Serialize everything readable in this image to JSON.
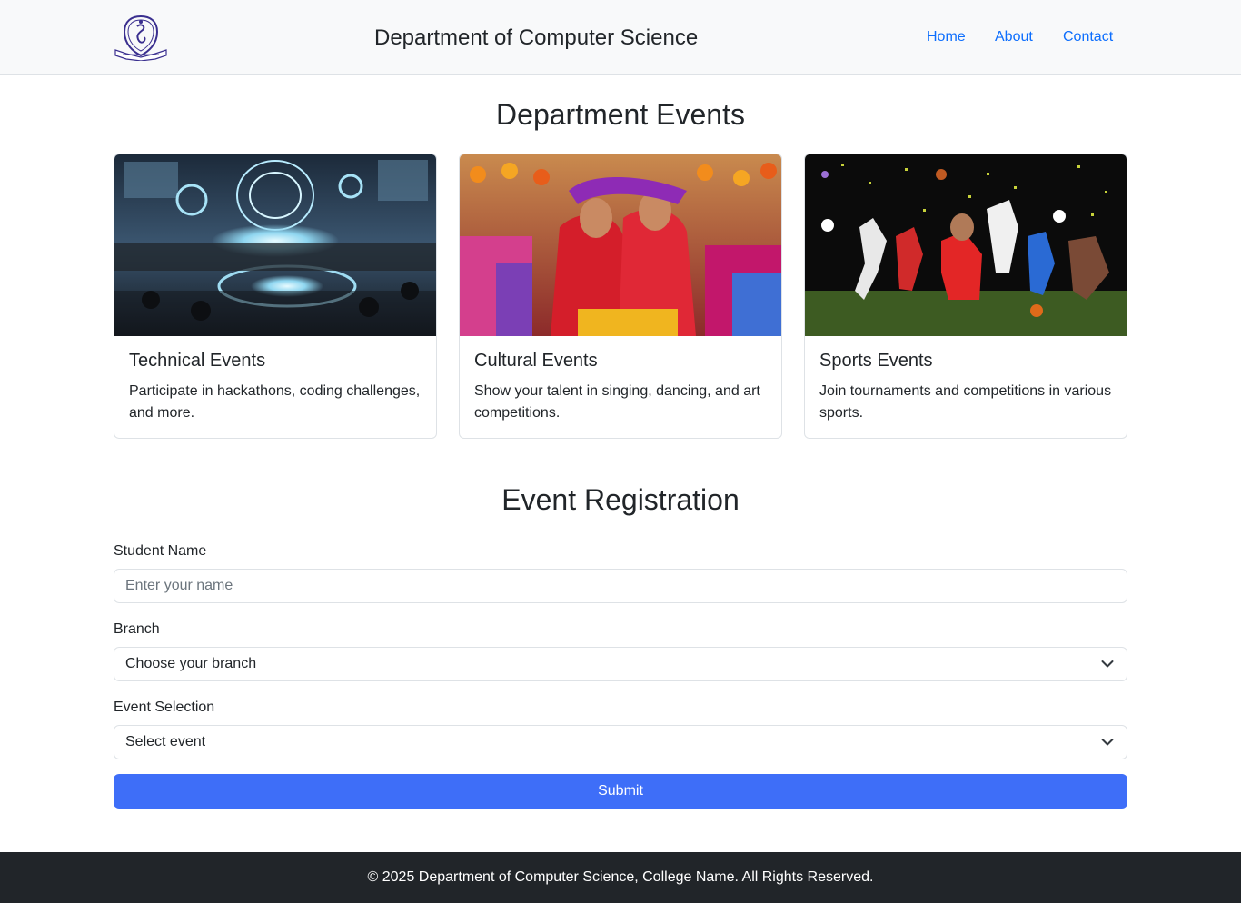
{
  "navbar": {
    "logo_icon": "college-crest-icon",
    "title": "Department of Computer Science",
    "links": [
      {
        "label": "Home"
      },
      {
        "label": "About"
      },
      {
        "label": "Contact"
      }
    ]
  },
  "events_section": {
    "heading": "Department Events",
    "cards": [
      {
        "title": "Technical Events",
        "text": "Participate in hackathons, coding challenges, and more.",
        "image": "technical-events-image"
      },
      {
        "title": "Cultural Events",
        "text": "Show your talent in singing, dancing, and art competitions.",
        "image": "cultural-events-image"
      },
      {
        "title": "Sports Events",
        "text": "Join tournaments and competitions in various sports.",
        "image": "sports-events-image"
      }
    ]
  },
  "registration": {
    "heading": "Event Registration",
    "student_name": {
      "label": "Student Name",
      "placeholder": "Enter your name",
      "value": ""
    },
    "branch": {
      "label": "Branch",
      "selected": "Choose your branch"
    },
    "event": {
      "label": "Event Selection",
      "selected": "Select event"
    },
    "submit_label": "Submit"
  },
  "footer": {
    "text": "© 2025 Department of Computer Science, College Name. All Rights Reserved."
  },
  "colors": {
    "navbar_bg": "#f8f9fa",
    "link": "#0d6efd",
    "primary_button": "#3e6ef8",
    "footer_bg": "#212529"
  }
}
